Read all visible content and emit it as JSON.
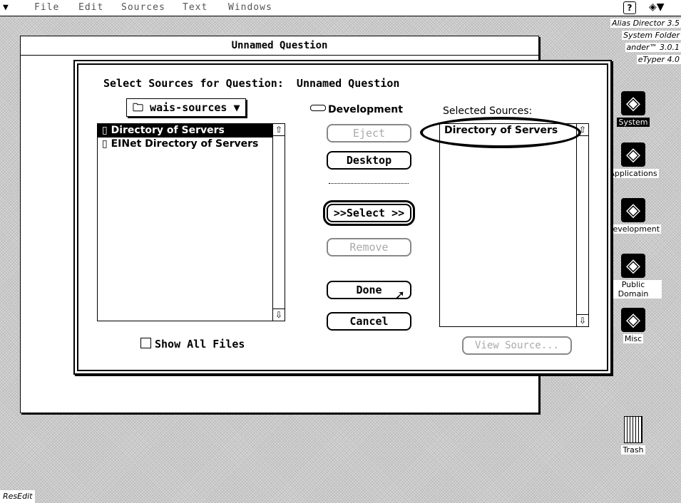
{
  "menubar": {
    "items": [
      "File",
      "Edit",
      "Sources",
      "Text",
      "Windows"
    ],
    "help_glyph": "?"
  },
  "background_window": {
    "title": "Unnamed Question"
  },
  "alias_panel": {
    "lines": [
      "Alias Director 3.5",
      "System Folder",
      "ander™ 3.0.1",
      "eTyper 4.0"
    ]
  },
  "dialog": {
    "heading": "Select Sources for Question:  Unnamed Question",
    "folder_popup": "wais-sources",
    "volume_label": "Development",
    "left_list": {
      "items": [
        {
          "label": "Directory of Servers",
          "selected": true
        },
        {
          "label": "EINet Directory of Servers",
          "selected": false
        }
      ]
    },
    "buttons": {
      "eject": "Eject",
      "desktop": "Desktop",
      "select": ">>Select >>",
      "remove": "Remove",
      "done": "Done",
      "cancel": "Cancel",
      "view_source": "View Source..."
    },
    "show_all_files": "Show All Files",
    "selected_sources_label": "Selected Sources:",
    "right_list": {
      "items": [
        {
          "label": "Directory of Servers"
        }
      ]
    }
  },
  "desktop_icons": [
    {
      "label": "System"
    },
    {
      "label": "Applications"
    },
    {
      "label": "Development"
    },
    {
      "label": "Public Domain"
    },
    {
      "label": "Misc"
    },
    {
      "label": "Trash"
    }
  ],
  "status_label": "ResEdit"
}
